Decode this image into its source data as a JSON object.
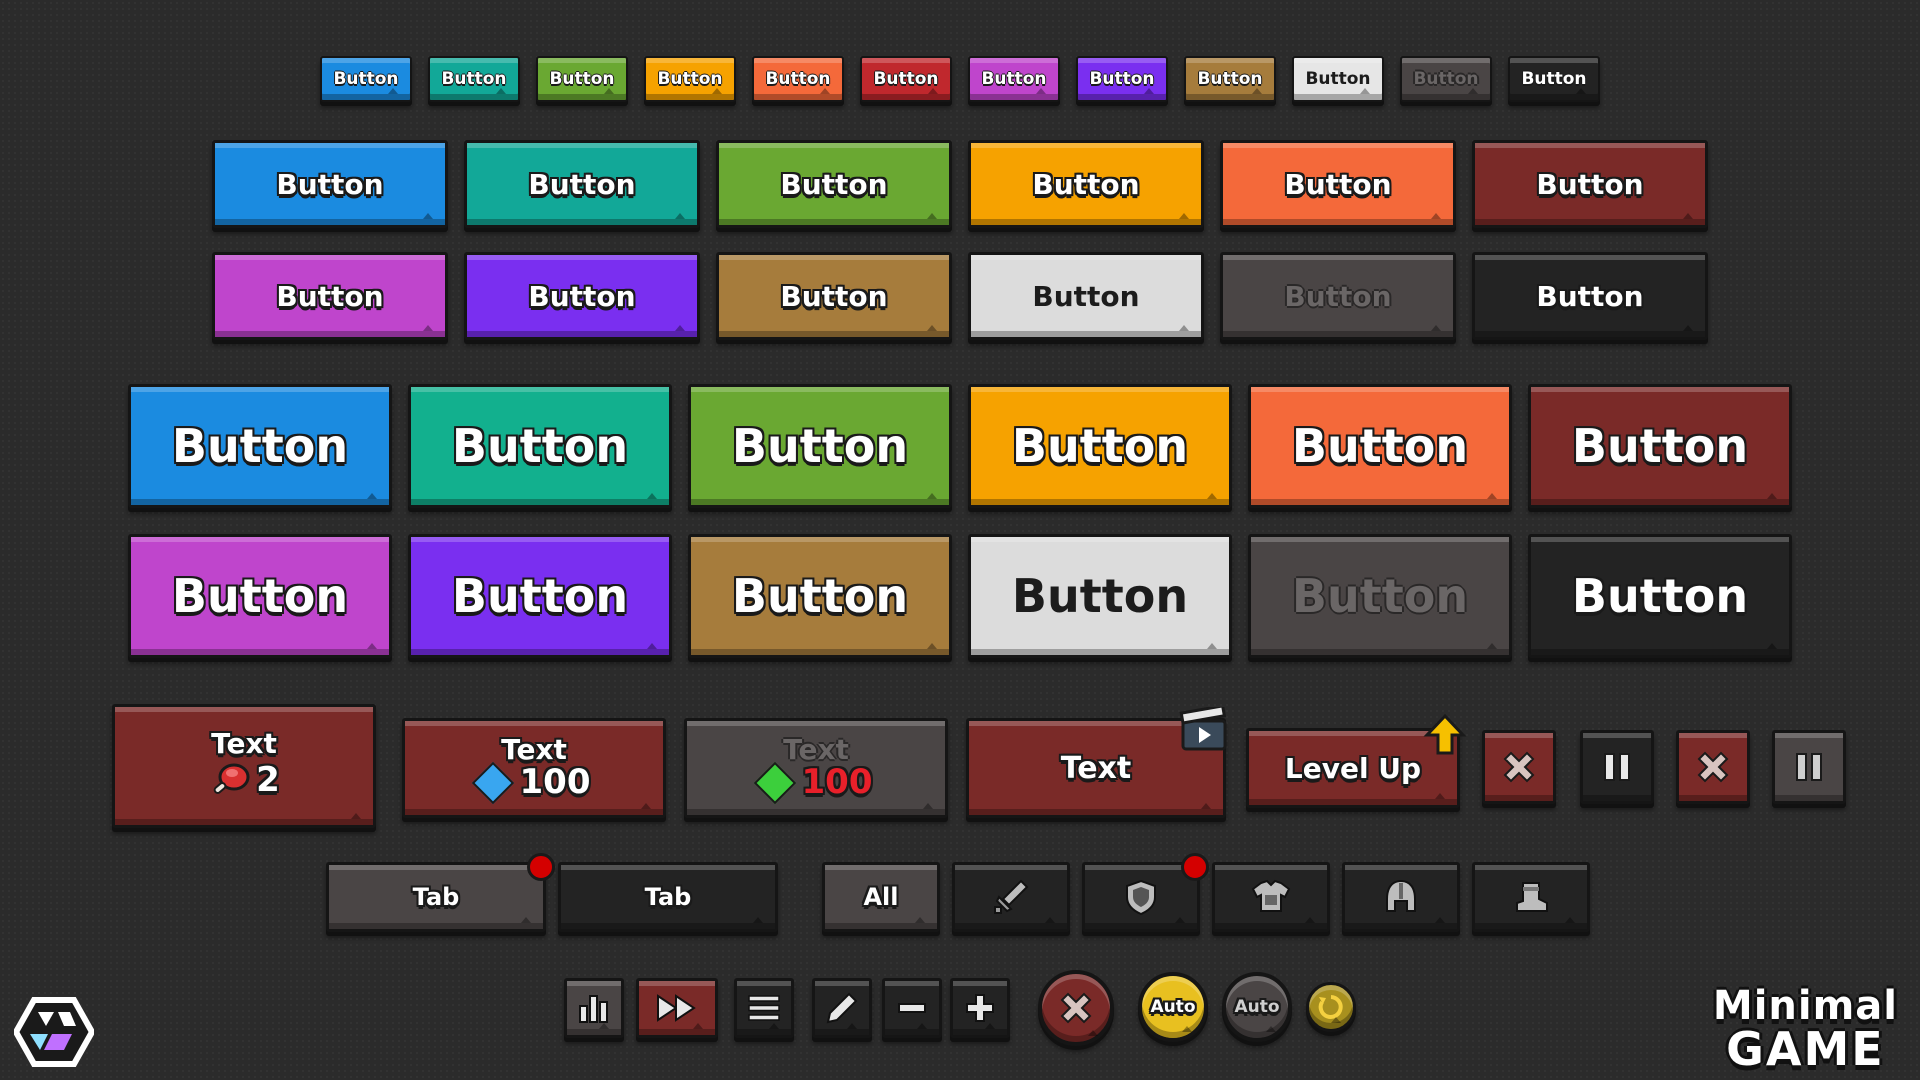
{
  "palette": {
    "blue": "#1b8be0",
    "teal": "#12a898",
    "green": "#6aa832",
    "orange": "#f6a200",
    "orange_red": "#f4693a",
    "dark_red": "#7a2a28",
    "magenta": "#bf45cc",
    "purple": "#7a2ff0",
    "brown": "#a67c3c",
    "white": "#dcdcdc",
    "disabled": "#4a4545",
    "black": "#232323",
    "gold": "#e8c020",
    "notify_red": "#d40000"
  },
  "xs_buttons": [
    {
      "label": "Button",
      "color": "#1b8be0",
      "style": "normal"
    },
    {
      "label": "Button",
      "color": "#12a898",
      "style": "normal"
    },
    {
      "label": "Button",
      "color": "#6aa832",
      "style": "normal"
    },
    {
      "label": "Button",
      "color": "#f6a200",
      "style": "normal"
    },
    {
      "label": "Button",
      "color": "#f4693a",
      "style": "normal"
    },
    {
      "label": "Button",
      "color": "#c0282d",
      "style": "normal"
    },
    {
      "label": "Button",
      "color": "#bf45cc",
      "style": "normal"
    },
    {
      "label": "Button",
      "color": "#7a2ff0",
      "style": "normal"
    },
    {
      "label": "Button",
      "color": "#a67c3c",
      "style": "normal"
    },
    {
      "label": "Button",
      "color": "#e6e6e6",
      "style": "dark"
    },
    {
      "label": "Button",
      "color": "#4a4545",
      "style": "disabled"
    },
    {
      "label": "Button",
      "color": "#232323",
      "style": "normal"
    }
  ],
  "md_row1": [
    {
      "label": "Button",
      "color": "#1b8be0",
      "style": "normal"
    },
    {
      "label": "Button",
      "color": "#12a898",
      "style": "normal"
    },
    {
      "label": "Button",
      "color": "#6aa832",
      "style": "normal"
    },
    {
      "label": "Button",
      "color": "#f6a200",
      "style": "normal"
    },
    {
      "label": "Button",
      "color": "#f4693a",
      "style": "normal"
    },
    {
      "label": "Button",
      "color": "#7a2a28",
      "style": "normal"
    }
  ],
  "md_row2": [
    {
      "label": "Button",
      "color": "#bf45cc",
      "style": "normal"
    },
    {
      "label": "Button",
      "color": "#7a2ff0",
      "style": "normal"
    },
    {
      "label": "Button",
      "color": "#a67c3c",
      "style": "normal"
    },
    {
      "label": "Button",
      "color": "#dcdcdc",
      "style": "dark"
    },
    {
      "label": "Button",
      "color": "#4a4545",
      "style": "disabled"
    },
    {
      "label": "Button",
      "color": "#232323",
      "style": "normal"
    }
  ],
  "lg_row1": [
    {
      "label": "Button",
      "color": "#1b8be0",
      "style": "normal"
    },
    {
      "label": "Button",
      "color": "#12b08e",
      "style": "normal"
    },
    {
      "label": "Button",
      "color": "#6aa832",
      "style": "normal"
    },
    {
      "label": "Button",
      "color": "#f6a200",
      "style": "normal"
    },
    {
      "label": "Button",
      "color": "#f4693a",
      "style": "normal"
    },
    {
      "label": "Button",
      "color": "#7a2a28",
      "style": "normal"
    }
  ],
  "lg_row2": [
    {
      "label": "Button",
      "color": "#bf45cc",
      "style": "normal"
    },
    {
      "label": "Button",
      "color": "#7a2ff0",
      "style": "normal"
    },
    {
      "label": "Button",
      "color": "#a67c3c",
      "style": "normal"
    },
    {
      "label": "Button",
      "color": "#dcdcdc",
      "style": "dark"
    },
    {
      "label": "Button",
      "color": "#4a4545",
      "style": "disabled"
    },
    {
      "label": "Button",
      "color": "#232323",
      "style": "normal"
    }
  ],
  "misc": {
    "meat_button": {
      "text": "Text",
      "count": "2",
      "icon": "meat-icon"
    },
    "diamond_button": {
      "text": "Text",
      "count": "100",
      "icon": "blue-gem-icon",
      "gem_color": "#39a6f0"
    },
    "green_gem_button": {
      "text": "Text",
      "count": "100",
      "icon": "green-gem-icon",
      "gem_color": "#3ccf3c",
      "count_color": "#e8202a"
    },
    "video_button": {
      "text": "Text",
      "icon": "video-ad-icon"
    },
    "level_up_button": {
      "text": "Level Up",
      "icon": "up-arrow-icon"
    },
    "close_red_1": {
      "icon": "close-icon"
    },
    "pause_dark_1": {
      "icon": "pause-icon"
    },
    "close_red_2": {
      "icon": "close-icon"
    },
    "pause_dark_2": {
      "icon": "pause-icon"
    }
  },
  "tabs": {
    "tab_active": {
      "label": "Tab"
    },
    "tab_inactive": {
      "label": "Tab"
    },
    "filter_all": {
      "label": "All"
    },
    "filters": [
      {
        "icon": "sword-icon"
      },
      {
        "icon": "shield-icon"
      },
      {
        "icon": "armor-icon"
      },
      {
        "icon": "helmet-icon"
      },
      {
        "icon": "boot-icon"
      }
    ]
  },
  "toolbar": {
    "stats": {
      "icon": "bar-chart-icon"
    },
    "fast_forward": {
      "icon": "fast-forward-icon"
    },
    "menu": {
      "icon": "menu-icon"
    },
    "edit": {
      "icon": "pencil-icon"
    },
    "minus": {
      "icon": "minus-icon"
    },
    "plus": {
      "icon": "plus-icon"
    },
    "close_round": {
      "icon": "close-icon"
    },
    "auto_on": {
      "label": "Auto"
    },
    "auto_off": {
      "label": "Auto"
    },
    "refresh": {
      "icon": "refresh-icon"
    }
  },
  "brand": {
    "line1": "Minimal",
    "line2": "GAME"
  }
}
